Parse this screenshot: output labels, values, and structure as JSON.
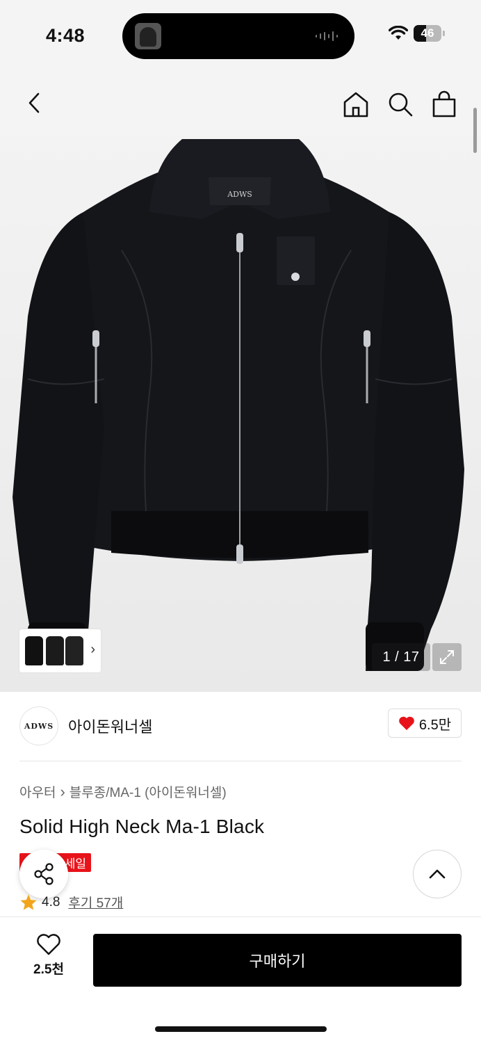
{
  "status_bar": {
    "time": "4:48",
    "battery": "46"
  },
  "product": {
    "image_counter": "1 / 17",
    "garment_label": "ADWS",
    "brand": {
      "logo_text": "ADWS",
      "name": "아이돈워너셀",
      "like_count": "6.5만"
    },
    "breadcrumb": {
      "category": "아우터",
      "separator": "›",
      "subcategory": "블루종/MA-1 (아이돈워너셀)"
    },
    "title": "Solid High Neck Ma-1 Black",
    "badge": "세일",
    "rating": {
      "score": "4.8",
      "reviews": "후기 57개"
    }
  },
  "bottom_bar": {
    "wish_count": "2.5천",
    "buy_label": "구매하기"
  },
  "colors": {
    "sale_red": "#e8131a",
    "heart_red": "#e8131a",
    "star": "#f2a51a",
    "cta": "#000000"
  },
  "icons": [
    "back-icon",
    "home-icon",
    "search-icon",
    "bag-icon",
    "expand-icon",
    "heart-icon",
    "share-icon",
    "chevron-up-icon",
    "star-icon",
    "wifi-icon"
  ]
}
